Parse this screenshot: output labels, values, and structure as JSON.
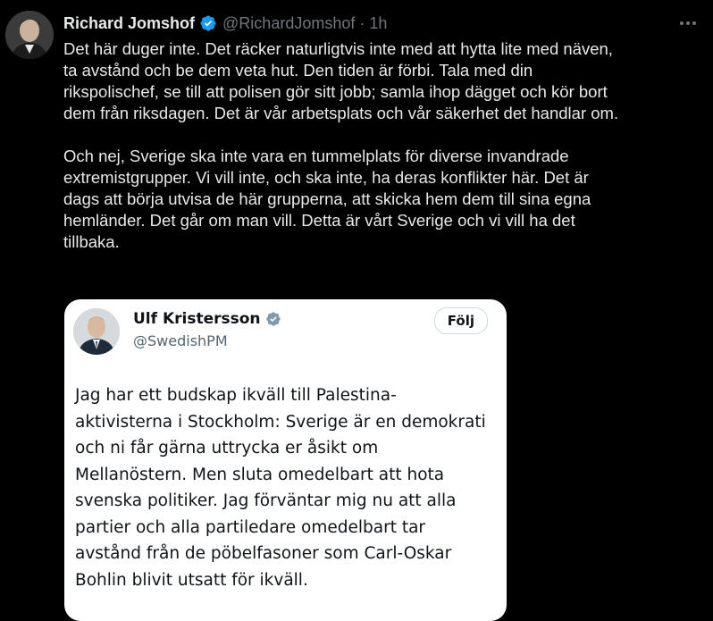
{
  "tweet": {
    "author_name": "Richard Jomshof",
    "handle": "@RichardJomshof",
    "separator": "·",
    "time": "1h",
    "paragraphs": [
      "Det här duger inte. Det räcker naturligtvis inte med att hytta lite med näven,\nta avstånd och be dem veta hut. Den tiden är förbi. Tala med din\nrikspolischef, se till att polisen gör sitt jobb; samla ihop dägget och kör bort\ndem från riksdagen. Det är vår arbetsplats och vår säkerhet det handlar om.",
      "Och nej, Sverige ska inte vara en tummelplats för diverse invandrade\nextremistgrupper. Vi vill inte, och ska inte, ha deras konflikter här. Det är\ndags att börja utvisa de här grupperna, att skicka hem dem till sina egna\nhemländer. Det går om man vill. Detta är vårt Sverige och vi vill ha det\ntillbaka."
    ],
    "verified_color": "#1d9bf0"
  },
  "quoted": {
    "author_name": "Ulf Kristersson",
    "handle": "@SwedishPM",
    "follow_label": "Följ",
    "text": "Jag har ett budskap ikväll till Palestina-\naktivisterna i Stockholm: Sverige är en demokrati\noch ni får gärna uttrycka er åsikt om\nMellanöstern. Men sluta omedelbart att hota\nsvenska politiker. Jag förväntar mig nu att alla\npartier och alla partiledare omedelbart tar\navstånd från de pöbelfasoner som Carl-Oskar\nBohlin blivit utsatt för ikväll.",
    "verified_color": "#829aab"
  }
}
